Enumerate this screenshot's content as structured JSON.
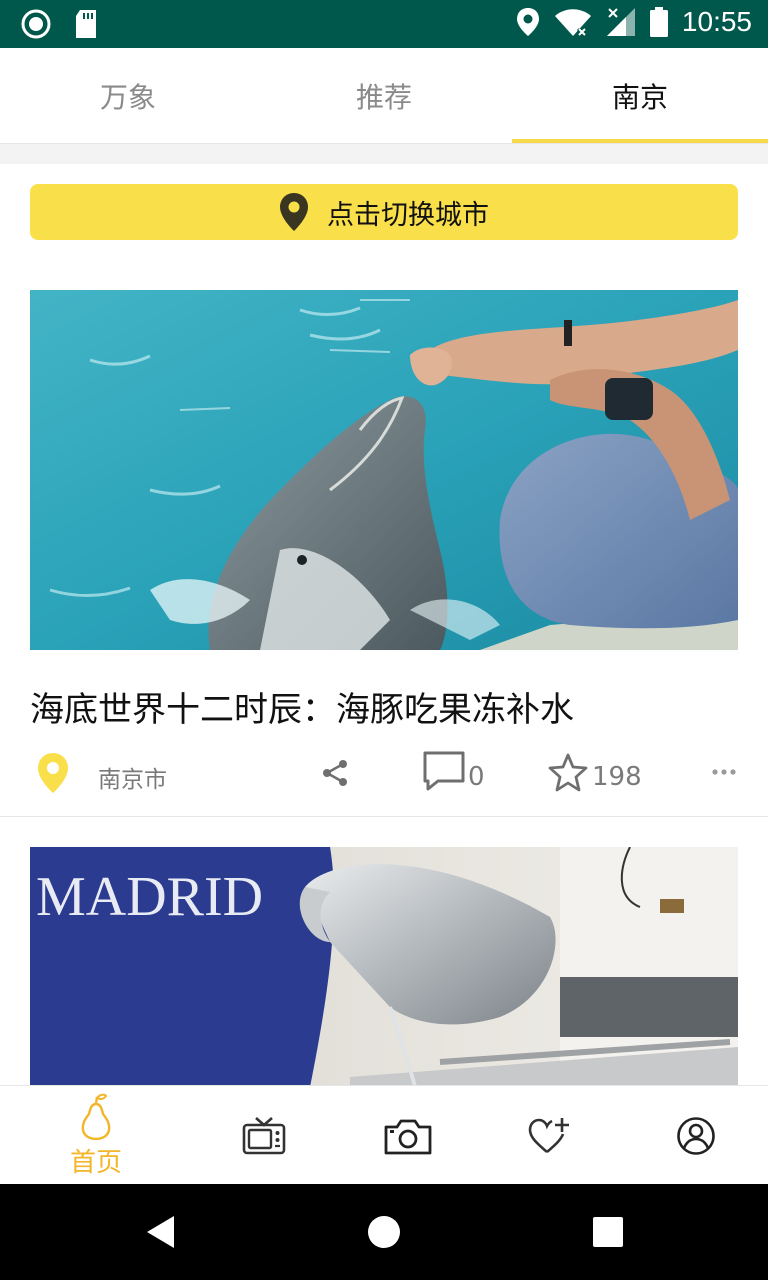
{
  "status_bar": {
    "time": "10:55",
    "left_icons": [
      "circle-notification-icon",
      "sd-card-icon"
    ],
    "right_icons": [
      "location-icon",
      "wifi-icon",
      "signal-icon",
      "battery-icon"
    ]
  },
  "tabs": [
    {
      "label": "万象",
      "active": false
    },
    {
      "label": "推荐",
      "active": false
    },
    {
      "label": "南京",
      "active": true
    }
  ],
  "city_switch": {
    "label": "点击切换城市",
    "icon": "location-pin-icon"
  },
  "feed": [
    {
      "title": "海底世界十二时辰：海豚吃果冻补水",
      "location": "南京市",
      "comments": "0",
      "stars": "198"
    },
    {
      "image_text": "MADRID"
    }
  ],
  "bottom_nav": {
    "items": [
      {
        "name": "home",
        "label": "首页",
        "icon": "pear-icon",
        "active": true
      },
      {
        "name": "tv",
        "icon": "tv-icon"
      },
      {
        "name": "camera",
        "icon": "camera-icon"
      },
      {
        "name": "favorite",
        "icon": "heart-plus-icon"
      },
      {
        "name": "profile",
        "icon": "user-icon"
      }
    ]
  },
  "colors": {
    "status_bar": "#00574b",
    "accent_yellow": "#f9df4a",
    "home_active": "#f3b52a"
  }
}
